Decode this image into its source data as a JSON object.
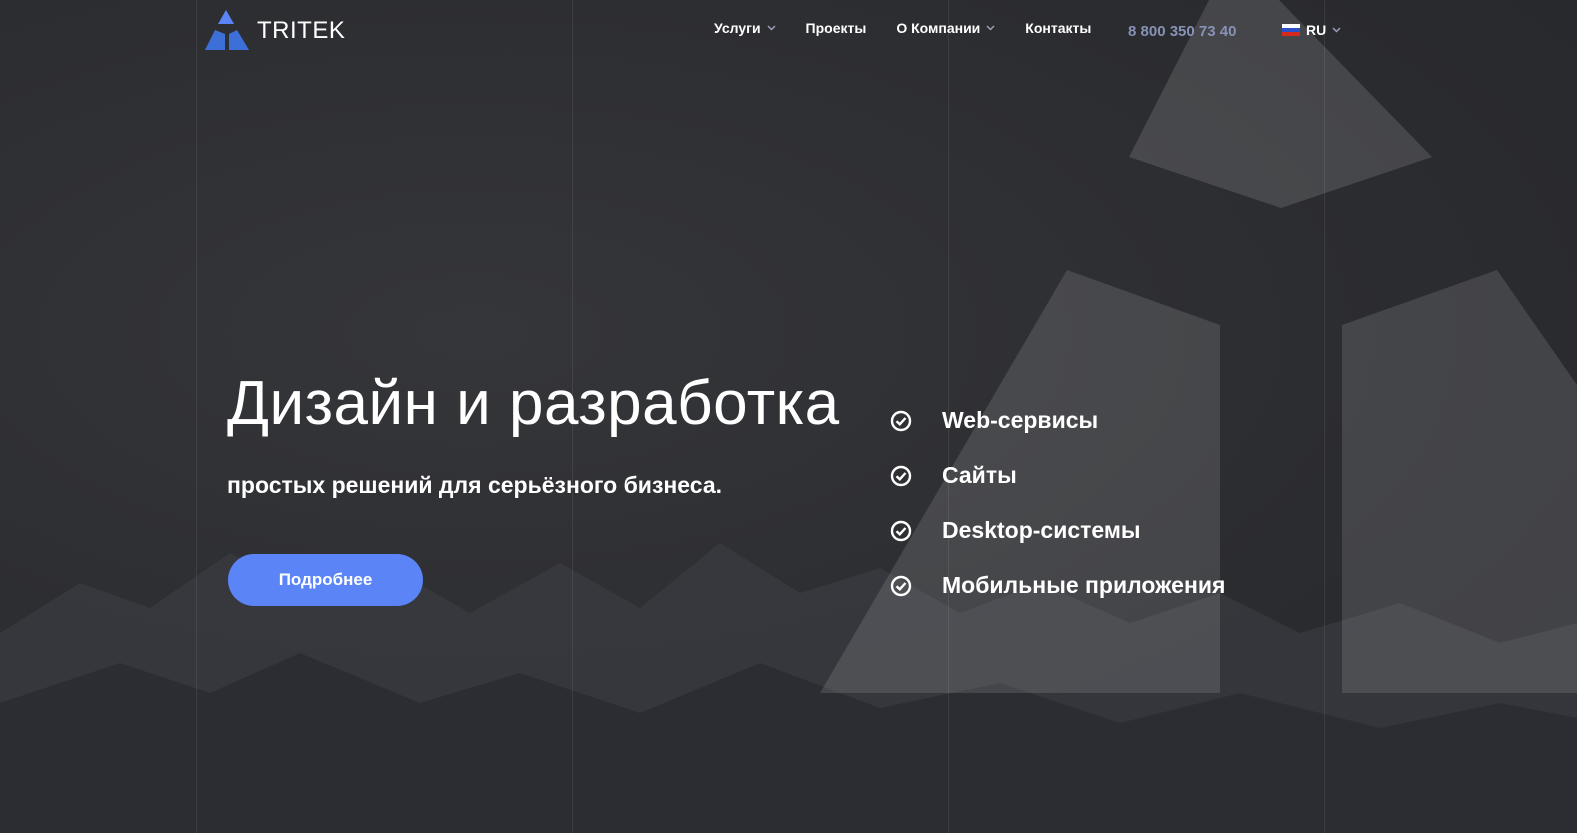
{
  "brand": {
    "name": "TRITEK",
    "accent": "#5b85f7"
  },
  "nav": {
    "items": [
      {
        "label": "Услуги",
        "has_dropdown": true
      },
      {
        "label": "Проекты",
        "has_dropdown": false
      },
      {
        "label": "О Компании",
        "has_dropdown": true
      },
      {
        "label": "Контакты",
        "has_dropdown": false
      }
    ],
    "phone": "8 800 350 73 40",
    "language": {
      "label": "RU",
      "flag_icon": "russia-flag-icon"
    }
  },
  "hero": {
    "title": "Дизайн и разработка",
    "subtitle": "простых решений для серьёзного бизнеса.",
    "cta_label": "Подробнее",
    "services": [
      {
        "label": "Web-сервисы",
        "icon": "check-circle-icon"
      },
      {
        "label": "Сайты",
        "icon": "check-circle-icon"
      },
      {
        "label": "Desktop-системы",
        "icon": "check-circle-icon"
      },
      {
        "label": "Мобильные приложения",
        "icon": "check-circle-icon"
      }
    ]
  },
  "colors": {
    "background": "#2e2f33",
    "phone_text": "#8892b4"
  }
}
